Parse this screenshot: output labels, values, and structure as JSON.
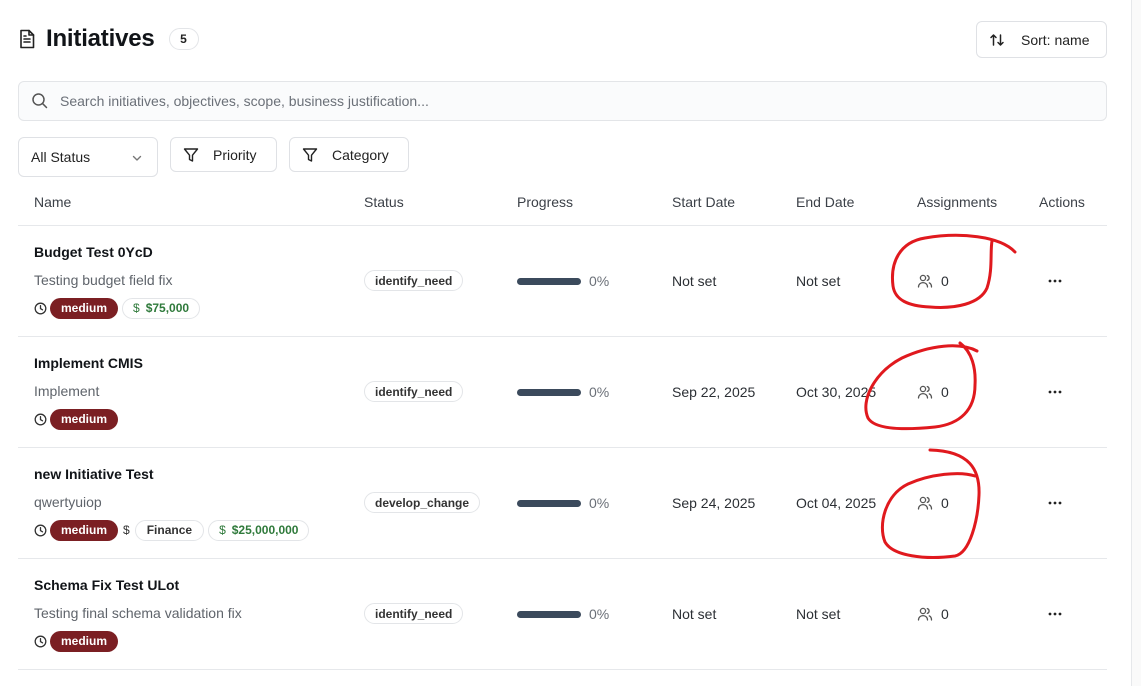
{
  "header": {
    "title": "Initiatives",
    "count": "5",
    "sort_label": "Sort: name"
  },
  "search": {
    "placeholder": "Search initiatives, objectives, scope, business justification..."
  },
  "filters": {
    "status_label": "All Status",
    "priority_label": "Priority",
    "category_label": "Category"
  },
  "columns": {
    "name": "Name",
    "status": "Status",
    "progress": "Progress",
    "start_date": "Start Date",
    "end_date": "End Date",
    "assignments": "Assignments",
    "actions": "Actions"
  },
  "rows": [
    {
      "name": "Budget Test 0YcD",
      "description": "Testing budget field fix",
      "priority": "medium",
      "budget": "$75,000",
      "category": "",
      "status": "identify_need",
      "progress": 0,
      "progress_label": "0%",
      "start": "Not set",
      "end": "Not set",
      "assignments": "0"
    },
    {
      "name": "Implement CMIS",
      "description": "Implement",
      "priority": "medium",
      "budget": "",
      "category": "",
      "status": "identify_need",
      "progress": 0,
      "progress_label": "0%",
      "start": "Sep 22, 2025",
      "end": "Oct 30, 2025",
      "assignments": "0"
    },
    {
      "name": "new Initiative Test",
      "description": "qwertyuiop",
      "priority": "medium",
      "budget": "$25,000,000",
      "category": "Finance",
      "status": "develop_change",
      "progress": 0,
      "progress_label": "0%",
      "start": "Sep 24, 2025",
      "end": "Oct 04, 2025",
      "assignments": "0"
    },
    {
      "name": "Schema Fix Test ULot",
      "description": "Testing final schema validation fix",
      "priority": "medium",
      "budget": "",
      "category": "",
      "status": "identify_need",
      "progress": 0,
      "progress_label": "0%",
      "start": "Not set",
      "end": "Not set",
      "assignments": "0"
    }
  ],
  "colors": {
    "priority_badge": "#7b1f23",
    "budget_text": "#2f7a3b",
    "progress_fill": "#3b4a5c",
    "annotation": "#e0191e"
  },
  "icons": {
    "title": "document-icon",
    "sort": "sort-arrows-icon",
    "search": "search-icon",
    "filter": "filter-icon",
    "clock": "clock-icon",
    "users": "users-icon",
    "actions": "more-horizontal-icon"
  }
}
